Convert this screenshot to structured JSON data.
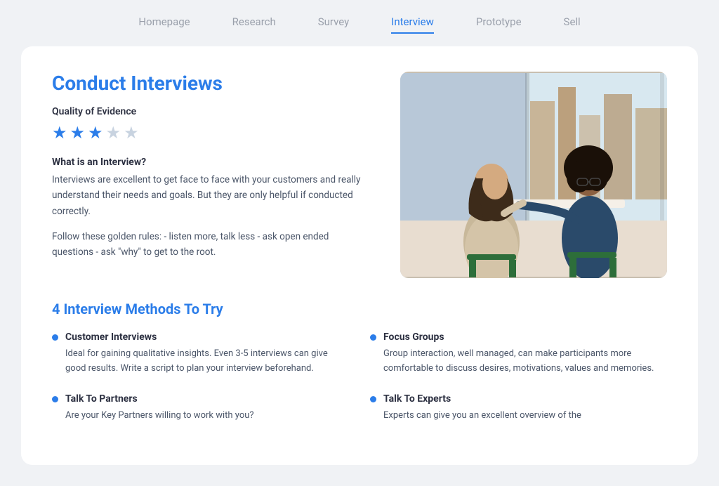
{
  "nav": {
    "items": [
      {
        "label": "Homepage",
        "active": false
      },
      {
        "label": "Research",
        "active": false
      },
      {
        "label": "Survey",
        "active": false
      },
      {
        "label": "Interview",
        "active": true
      },
      {
        "label": "Prototype",
        "active": false
      },
      {
        "label": "Sell",
        "active": false
      }
    ]
  },
  "page": {
    "title": "Conduct Interviews",
    "quality_label": "Quality of Evidence",
    "stars": [
      true,
      true,
      true,
      false,
      false
    ],
    "what_is_heading": "What is an Interview?",
    "what_is_text": "Interviews are excellent to get face to face with your customers and really understand their needs and goals. But they are only helpful if conducted correctly.",
    "golden_rules_text": "Follow these golden rules: - listen more, talk less - ask open ended questions - ask \"why\" to get to the root.",
    "methods_title": "4 Interview Methods To Try",
    "methods": [
      {
        "name": "Customer Interviews",
        "desc": "Ideal for gaining qualitative insights. Even 3-5 interviews can give good results. Write a script to plan your interview beforehand."
      },
      {
        "name": "Focus Groups",
        "desc": "Group interaction, well managed, can make participants more comfortable to discuss desires, motivations, values and memories."
      },
      {
        "name": "Talk To Partners",
        "desc": "Are your Key Partners willing to work with you?"
      },
      {
        "name": "Talk To Experts",
        "desc": "Experts can give you an excellent overview of the"
      }
    ]
  },
  "colors": {
    "accent": "#2b7de9",
    "text_dark": "#2d3142",
    "text_body": "#4a5568",
    "text_nav": "#9aa0ab",
    "star_filled": "#2b7de9",
    "star_empty": "#c8d3e0"
  }
}
